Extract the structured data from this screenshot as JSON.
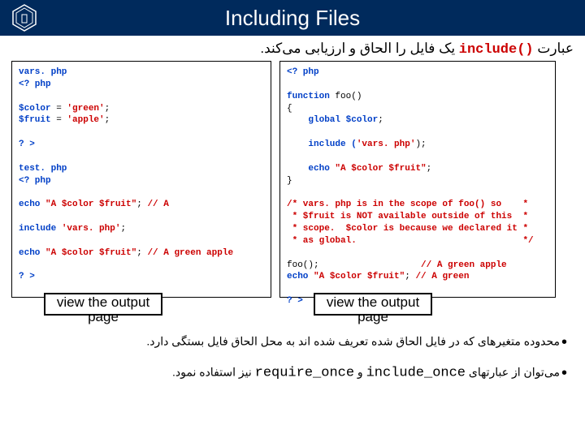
{
  "header": {
    "title": "Including Files"
  },
  "subtitle": {
    "keyword": "include()",
    "pre": "عبارت ",
    "post": " یک فایل را الحاق و ارزیابی می‌کند."
  },
  "code_left": {
    "l1": "vars. php",
    "l2": "<? php",
    "l3": "",
    "l4a": "$color",
    "l4b": " = ",
    "l4c": "'green'",
    "l4d": ";",
    "l5a": "$fruit",
    "l5b": " = ",
    "l5c": "'apple'",
    "l5d": ";",
    "l6": "",
    "l7": "? >",
    "l8": "",
    "l9": "test. php",
    "l10": "<? php",
    "l11": "",
    "l12a": "echo ",
    "l12b": "\"A $color $fruit\"",
    "l12c": "; ",
    "l12d": "// A",
    "l13": "",
    "l14a": "include ",
    "l14b": "'vars. php'",
    "l14c": ";",
    "l15": "",
    "l16a": "echo ",
    "l16b": "\"A $color $fruit\"",
    "l16c": "; ",
    "l16d": "// A green apple",
    "l17": "",
    "l18": "? >"
  },
  "code_right": {
    "l1": "<? php",
    "l2": "",
    "l3a": "function ",
    "l3b": "foo()",
    "l4": "{",
    "l5a": "    global ",
    "l5b": "$color",
    "l5c": ";",
    "l6": "",
    "l7a": "    include (",
    "l7b": "'vars. php'",
    "l7c": ");",
    "l8": "",
    "l9a": "    echo ",
    "l9b": "\"A $color $fruit\"",
    "l9c": ";",
    "l10": "}",
    "l11": "",
    "l12a": "/* vars. php is in the scope of foo() so    *",
    "l13a": " * $fruit is NOT available outside of this  *",
    "l14a": " * scope.  $color is because we declared it *",
    "l15a": " * as global.                               */",
    "l16": "",
    "l17a": "foo();                   ",
    "l17b": "// A green apple",
    "l18a": "echo ",
    "l18b": "\"A $color $fruit\"",
    "l18c": "; ",
    "l18d": "// A green",
    "l19": "",
    "l20": "? >"
  },
  "buttons": {
    "left": "view the output page",
    "right": "view the output page"
  },
  "bullets": {
    "b1": "محدوده متغیرهای که در فایل الحاق شده تعریف شده اند به محل الحاق فایل بستگی دارد.",
    "b2_pre": "می‌توان از عبارتهای ",
    "b2_k1": "include_once",
    "b2_mid": " و ",
    "b2_k2": "require_once",
    "b2_post": " نیز استفاده نمود."
  }
}
